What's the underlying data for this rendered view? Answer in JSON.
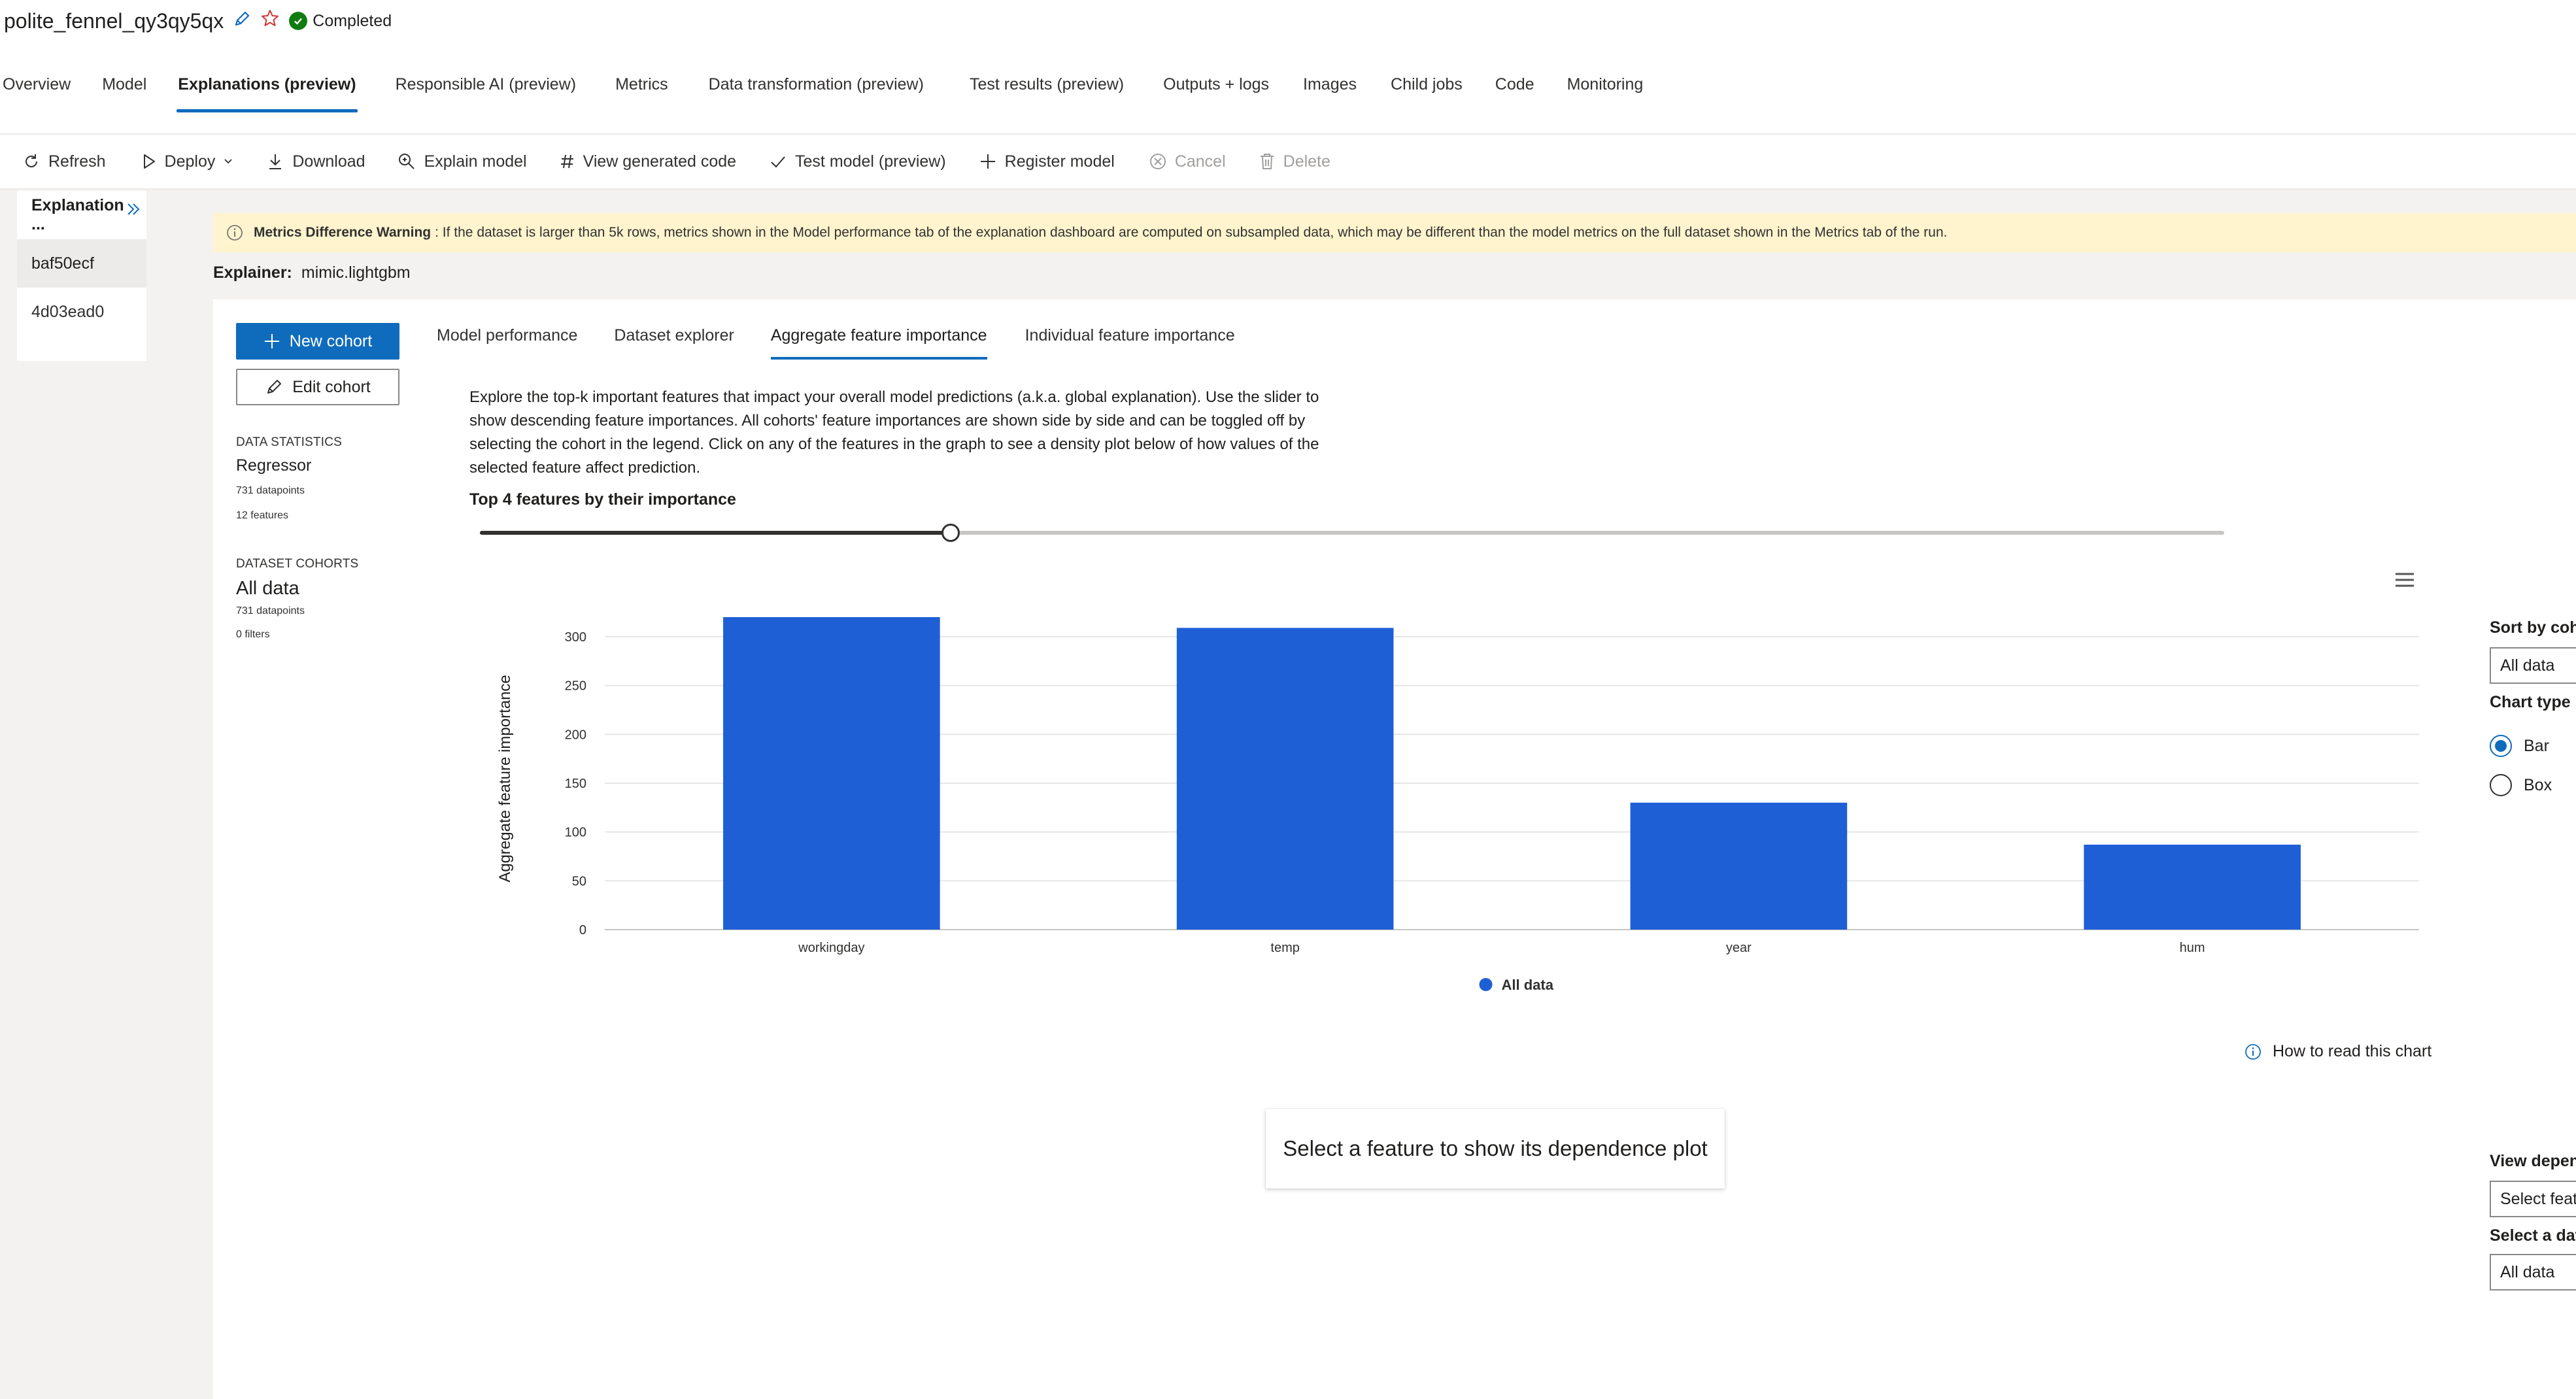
{
  "header": {
    "run_name": "polite_fennel_qy3qy5qx",
    "status": "Completed"
  },
  "tabs": [
    {
      "label": "Overview"
    },
    {
      "label": "Model"
    },
    {
      "label": "Explanations (preview)",
      "active": true
    },
    {
      "label": "Responsible AI (preview)"
    },
    {
      "label": "Metrics"
    },
    {
      "label": "Data transformation (preview)"
    },
    {
      "label": "Test results (preview)"
    },
    {
      "label": "Outputs + logs"
    },
    {
      "label": "Images"
    },
    {
      "label": "Child jobs"
    },
    {
      "label": "Code"
    },
    {
      "label": "Monitoring"
    }
  ],
  "toolbar": {
    "refresh": "Refresh",
    "deploy": "Deploy",
    "download": "Download",
    "explain_model": "Explain model",
    "view_generated_code": "View generated code",
    "test_model": "Test model (preview)",
    "register_model": "Register model",
    "cancel": "Cancel",
    "delete": "Delete"
  },
  "explanation_list": {
    "header": "Explanation ...",
    "items": [
      "baf50ecf",
      "4d03ead0"
    ]
  },
  "warning": {
    "title": "Metrics Difference Warning",
    "text": ": If the dataset is larger than 5k rows, metrics shown in the Model performance tab of the explanation dashboard are computed on subsampled data, which may be different than the model metrics on the full dataset shown in the Metrics tab of the run."
  },
  "explainer": {
    "label": "Explainer:",
    "value": "mimic.lightgbm"
  },
  "cohort_buttons": {
    "new": "New cohort",
    "edit": "Edit cohort"
  },
  "data_statistics": {
    "heading": "DATA STATISTICS",
    "type": "Regressor",
    "datapoints": "731 datapoints",
    "features": "12 features"
  },
  "dataset_cohorts": {
    "heading": "DATASET COHORTS",
    "name": "All data",
    "datapoints": "731 datapoints",
    "filters": "0 filters"
  },
  "subtabs": [
    {
      "label": "Model performance"
    },
    {
      "label": "Dataset explorer"
    },
    {
      "label": "Aggregate feature importance",
      "active": true
    },
    {
      "label": "Individual feature importance"
    }
  ],
  "description": "Explore the top-k important features that impact your overall model predictions (a.k.a. global explanation). Use the slider to show descending feature importances. All cohorts' feature importances are shown side by side and can be toggled off by selecting the cohort in the legend. Click on any of the features in the graph to see a density plot below of how values of the selected feature affect prediction.",
  "slider": {
    "label": "Top 4 features by their importance",
    "value": 4,
    "max": 12,
    "fraction": 0.27
  },
  "chart_data": {
    "type": "bar",
    "categories": [
      "workingday",
      "temp",
      "year",
      "hum"
    ],
    "series": [
      {
        "name": "All data",
        "values": [
          320,
          309,
          130,
          87
        ],
        "color": "#1f5fd6"
      }
    ],
    "ylabel": "Aggregate feature importance",
    "xlabel": "",
    "ylim": [
      0,
      320
    ],
    "yticks": [
      0,
      50,
      100,
      150,
      200,
      250,
      300
    ],
    "grid": true,
    "legend": "bottom-center"
  },
  "right_panel": {
    "sort_by_label": "Sort by coh",
    "sort_by_value": "All data",
    "chart_type_label": "Chart type",
    "chart_types": [
      {
        "label": "Bar",
        "selected": true
      },
      {
        "label": "Box",
        "selected": false
      }
    ],
    "view_dependence_label": "View depen",
    "view_dependence_value": "Select feat",
    "select_dataset_label": "Select a dat",
    "select_dataset_value": "All data"
  },
  "how_to_read": "How to read this chart",
  "dependence_placeholder": "Select a feature to show its dependence plot",
  "colors": {
    "accent": "#0f6cbd",
    "bar": "#1f5fd6",
    "warning_bg": "#fff4ce",
    "success": "#107c10"
  }
}
